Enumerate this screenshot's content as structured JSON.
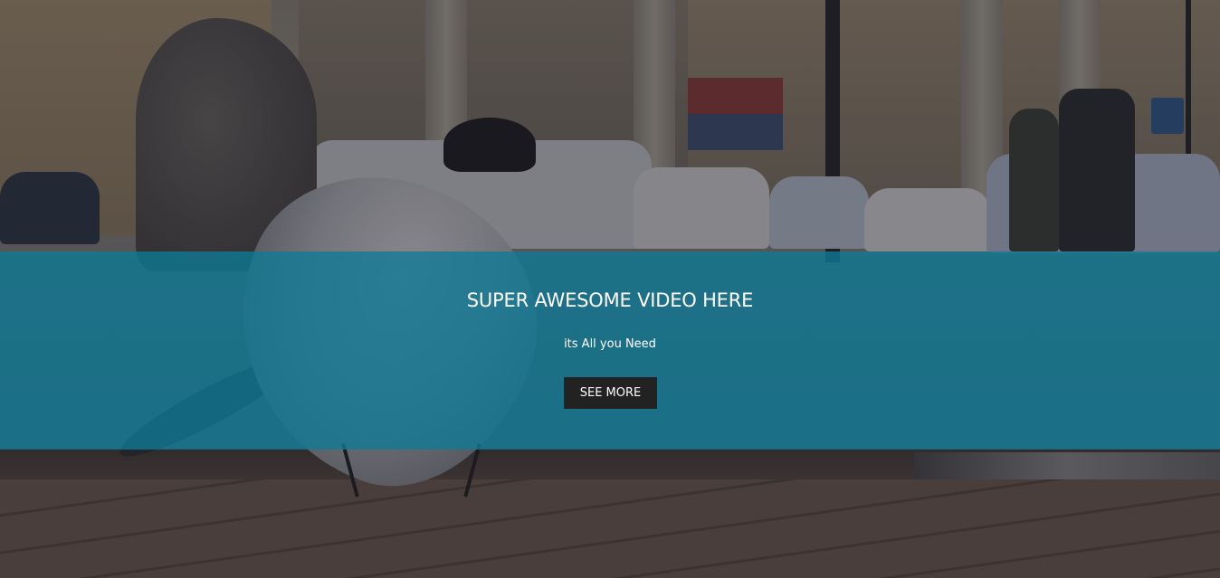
{
  "hero": {
    "title": "SUPER AWESOME VIDEO HERE",
    "subtitle": "its All you Need",
    "button_label": "SEE MORE"
  },
  "colors": {
    "band": "#0e7a96",
    "button": "#222222",
    "text": "#ffffff"
  }
}
